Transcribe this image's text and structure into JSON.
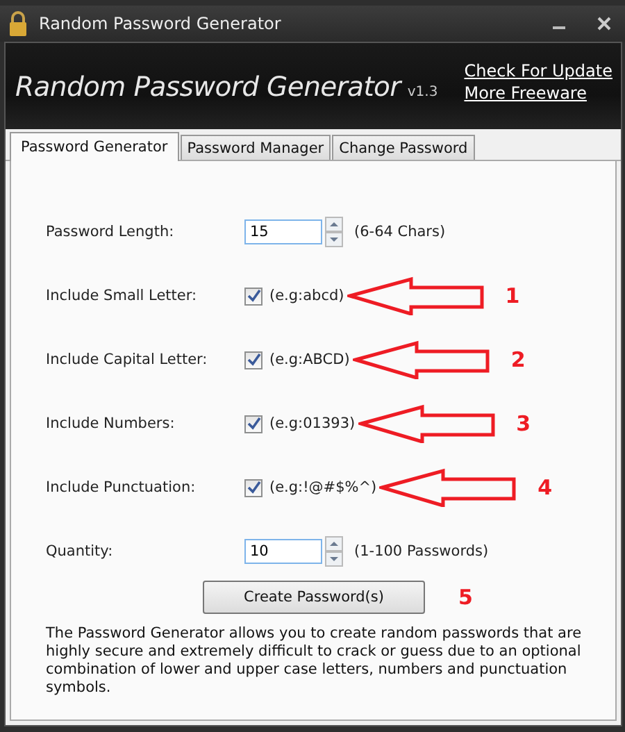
{
  "window": {
    "title": "Random Password Generator"
  },
  "header": {
    "title": "Random Password Generator",
    "version": "v1.3",
    "links": [
      "Check For Update",
      "More Freeware"
    ]
  },
  "tabs": [
    {
      "label": "Password Generator",
      "selected": true
    },
    {
      "label": "Password Manager",
      "selected": false
    },
    {
      "label": "Change Password",
      "selected": false
    }
  ],
  "options": [
    {
      "kind": "number",
      "label": "Password Length:",
      "value": "15",
      "hint": "(6-64 Chars)"
    },
    {
      "kind": "checkbox",
      "label": "Include Small Letter:",
      "checked": true,
      "hint": "(e.g:abcd)",
      "marker": "1"
    },
    {
      "kind": "checkbox",
      "label": "Include Capital Letter:",
      "checked": true,
      "hint": "(e.g:ABCD)",
      "marker": "2"
    },
    {
      "kind": "checkbox",
      "label": "Include Numbers:",
      "checked": true,
      "hint": "(e.g:01393)",
      "marker": "3"
    },
    {
      "kind": "checkbox",
      "label": "Include Punctuation:",
      "checked": true,
      "hint": "(e.g:!@#$%^)",
      "marker": "4"
    },
    {
      "kind": "number",
      "label": "Quantity:",
      "value": "10",
      "hint": "(1-100 Passwords)"
    }
  ],
  "create_button": {
    "label": "Create Password(s)",
    "marker": "5"
  },
  "description": "The Password Generator allows you to create random passwords that are highly secure and extremely difficult to crack or guess due to an optional combination of lower and upper case letters, numbers and punctuation symbols."
}
